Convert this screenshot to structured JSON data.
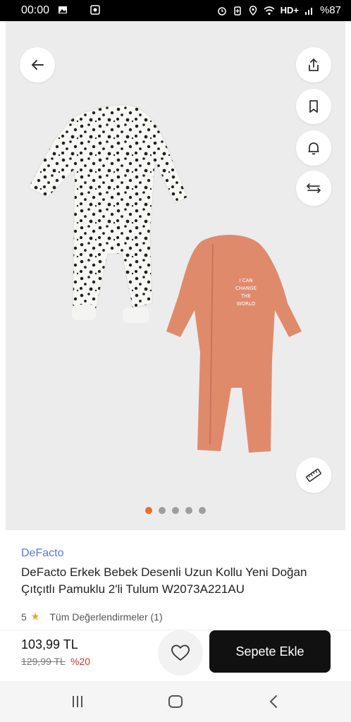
{
  "status_bar": {
    "time": "00:00",
    "network": "HD+",
    "battery": "%87",
    "icons": [
      "gallery-icon",
      "screen-record-icon",
      "alarm-icon",
      "battery-saver-icon",
      "location-icon",
      "wifi-icon",
      "signal-icon"
    ]
  },
  "gallery": {
    "image_count": 5,
    "active_index": 0,
    "print_text_lines": [
      "I CAN",
      "CHANGE",
      "THE",
      "WORLD"
    ],
    "buttons": [
      "back-arrow-icon",
      "share-icon",
      "bookmark-icon",
      "bell-icon",
      "compare-arrows-icon",
      "size-ruler-icon"
    ]
  },
  "product": {
    "brand": "DeFacto",
    "title": "DeFacto Erkek Bebek Desenli Uzun Kollu Yeni Doğan Çıtçıtlı Pamuklu 2'li Tulum W2073A221AU",
    "rating_value": "5",
    "reviews_label": "Tüm Değerlendirmeler (1)",
    "price": "103,99 TL",
    "old_price": "129,99 TL",
    "discount": "%20",
    "add_to_cart": "Sepete Ekle"
  },
  "colors": {
    "accent": "#f26b21",
    "brand_link": "#5a7ad6",
    "discount": "#d32f2f",
    "cta_background": "#111111",
    "romper_orange": "#e08a6c"
  },
  "nav_bar": {
    "icons": [
      "recent-apps-icon",
      "home-icon",
      "back-icon"
    ]
  }
}
